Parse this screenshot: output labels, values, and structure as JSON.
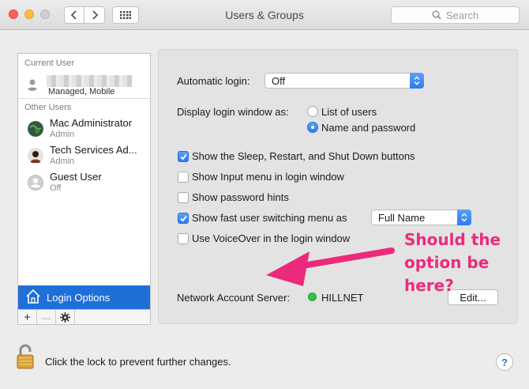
{
  "window": {
    "title": "Users & Groups",
    "search_placeholder": "Search"
  },
  "sidebar": {
    "current_user_header": "Current User",
    "current_user": {
      "name": "",
      "subtitle": "Managed, Mobile"
    },
    "other_users_header": "Other Users",
    "users": [
      {
        "name": "Mac Administrator",
        "role": "Admin"
      },
      {
        "name": "Tech Services Ad...",
        "role": "Admin"
      },
      {
        "name": "Guest User",
        "role": "Off"
      }
    ],
    "login_options_label": "Login Options",
    "add_label": "+",
    "remove_label": "—"
  },
  "panel": {
    "automatic_login_label": "Automatic login:",
    "automatic_login_value": "Off",
    "display_login_label": "Display login window as:",
    "radio_list": "List of users",
    "radio_name": "Name and password",
    "checkboxes": [
      {
        "label": "Show the Sleep, Restart, and Shut Down buttons",
        "checked": true
      },
      {
        "label": "Show Input menu in login window",
        "checked": false
      },
      {
        "label": "Show password hints",
        "checked": false
      },
      {
        "label": "Show fast user switching menu as",
        "checked": true
      },
      {
        "label": "Use VoiceOver in the login window",
        "checked": false
      }
    ],
    "fast_switch_value": "Full Name",
    "network_label": "Network Account Server:",
    "network_value": "HILLNET",
    "edit_button": "Edit..."
  },
  "annotation": {
    "line1": "Should the",
    "line2": "option be",
    "line3": "here?",
    "color": "#ec2a7b"
  },
  "bottom": {
    "lock_text": "Click the lock to prevent further changes.",
    "help_label": "?"
  },
  "colors": {
    "accent": "#2e7cf0",
    "selection": "#1f6fd8",
    "status_green": "#33c24b"
  }
}
